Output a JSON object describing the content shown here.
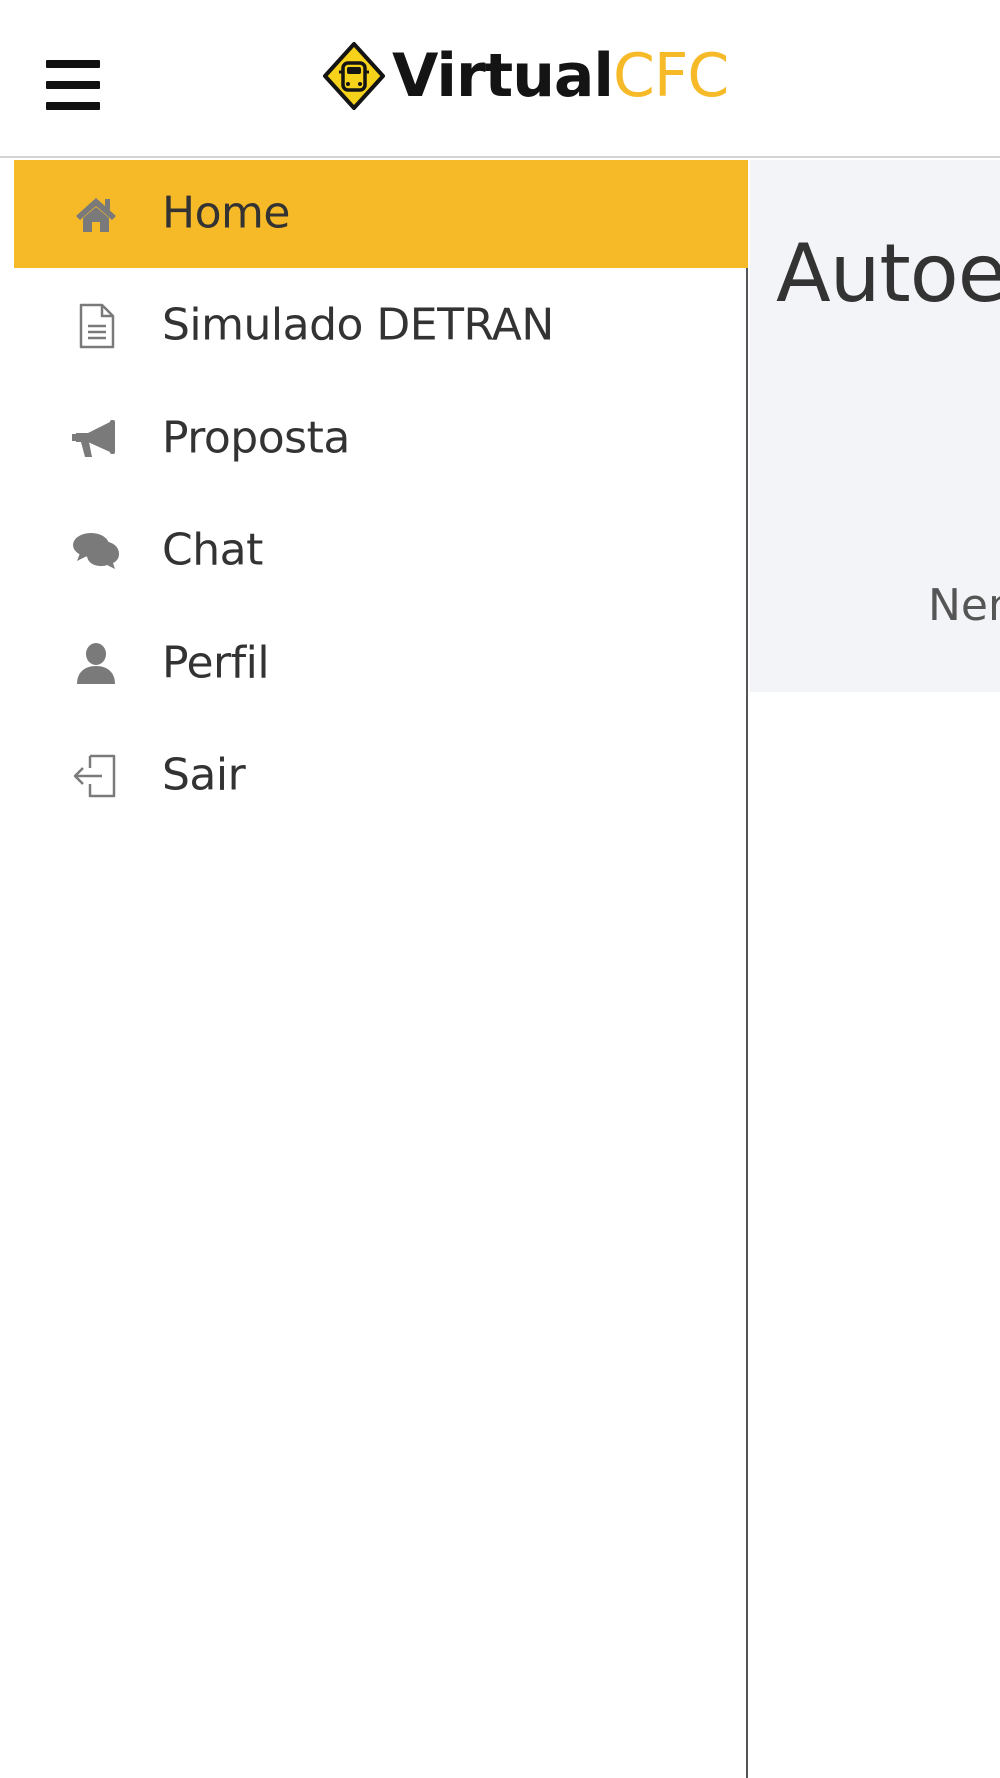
{
  "header": {
    "menu_icon": "hamburger-menu-icon",
    "logo": {
      "part1": "Virtual",
      "part2": "CFC",
      "icon": "road-sign-car-icon",
      "colors": {
        "dark": "#141414",
        "accent": "#f6b928"
      }
    }
  },
  "sidebar": {
    "items": [
      {
        "label": "Home",
        "icon": "home-icon",
        "active": true
      },
      {
        "label": "Simulado DETRAN",
        "icon": "document-icon",
        "active": false
      },
      {
        "label": "Proposta",
        "icon": "megaphone-icon",
        "active": false
      },
      {
        "label": "Chat",
        "icon": "chat-bubbles-icon",
        "active": false
      },
      {
        "label": "Perfil",
        "icon": "user-icon",
        "active": false
      },
      {
        "label": "Sair",
        "icon": "sign-out-icon",
        "active": false
      }
    ]
  },
  "main": {
    "title": "Autoes",
    "empty_text": "Nen"
  },
  "colors": {
    "accent": "#f6b928",
    "icon_gray": "#7a7a7a",
    "text": "#333333",
    "panel_bg": "#f3f4f8"
  }
}
